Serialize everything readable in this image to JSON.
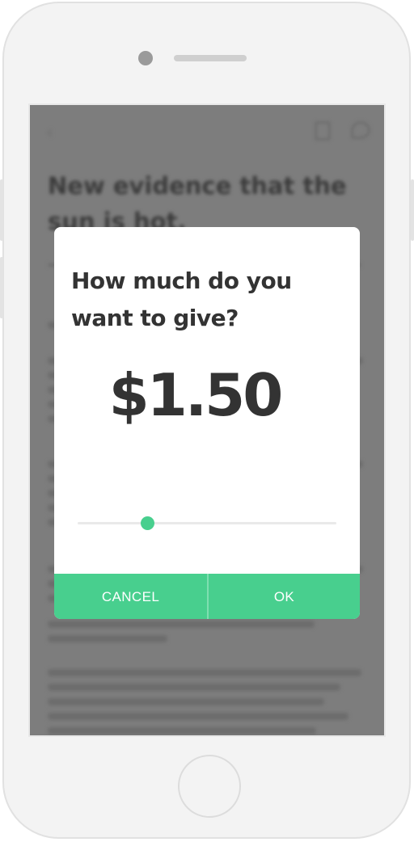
{
  "article": {
    "title": "New evidence that the sun is hot."
  },
  "dialog": {
    "title": "How much do you want to give?",
    "amount": "$1.50",
    "slider_value_fraction": 0.27,
    "cancel_label": "CANCEL",
    "ok_label": "OK"
  },
  "icons": {
    "back": "back-arrow-icon",
    "document": "document-icon",
    "comment": "comment-icon"
  },
  "colors": {
    "accent": "#48cf8e",
    "text": "#333333",
    "overlay": "#7e7e7e"
  }
}
